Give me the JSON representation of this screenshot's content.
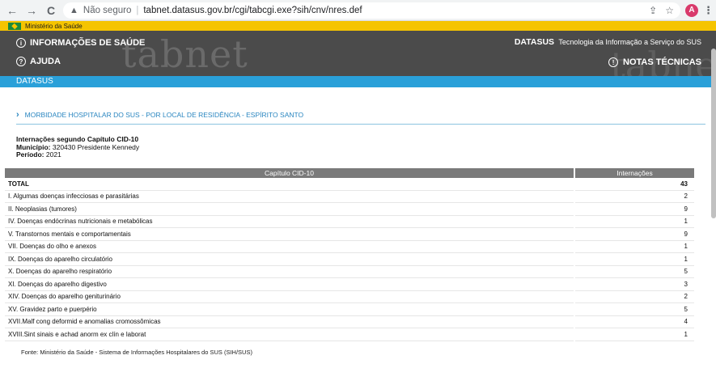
{
  "browser": {
    "back": "←",
    "forward": "→",
    "reload": "C",
    "warning_icon": "▲",
    "security_text": "Não seguro",
    "url": "tabnet.datasus.gov.br/cgi/tabcgi.exe?sih/cnv/nres.def",
    "share_icon": "⇪",
    "star_icon": "☆",
    "avatar_letter": "A",
    "menu_icon": "⋮"
  },
  "gov": {
    "label": "Ministério da Saúde"
  },
  "header": {
    "watermark": "tabnet",
    "info_label": "INFORMAÇÕES DE SAÚDE",
    "help_label": "AJUDA",
    "brand_name": "DATASUS",
    "brand_tagline": "Tecnologia da Informação a Serviço do SUS",
    "notes_label": "NOTAS TÉCNICAS"
  },
  "subbar": {
    "label": "DATASUS"
  },
  "report": {
    "title": "MORBIDADE HOSPITALAR DO SUS - POR LOCAL DE RESIDÊNCIA - ESPÍRITO SANTO",
    "subtitle": "Internações segundo Capítulo CID-10",
    "municipio_label": "Município:",
    "municipio_value": "320430 Presidente Kennedy",
    "periodo_label": "Período:",
    "periodo_value": "2021"
  },
  "table": {
    "headers": [
      "Capítulo CID-10",
      "Internações"
    ],
    "total": {
      "label": "TOTAL",
      "value": "43"
    },
    "rows": [
      {
        "label": "I. Algumas doenças infecciosas e parasitárias",
        "value": "2"
      },
      {
        "label": "II. Neoplasias (tumores)",
        "value": "9"
      },
      {
        "label": "IV. Doenças endócrinas nutricionais e metabólicas",
        "value": "1"
      },
      {
        "label": "V. Transtornos mentais e comportamentais",
        "value": "9"
      },
      {
        "label": "VII. Doenças do olho e anexos",
        "value": "1"
      },
      {
        "label": "IX. Doenças do aparelho circulatório",
        "value": "1"
      },
      {
        "label": "X. Doenças do aparelho respiratório",
        "value": "5"
      },
      {
        "label": "XI. Doenças do aparelho digestivo",
        "value": "3"
      },
      {
        "label": "XIV. Doenças do aparelho geniturinário",
        "value": "2"
      },
      {
        "label": "XV. Gravidez parto e puerpério",
        "value": "5"
      },
      {
        "label": "XVII.Malf cong deformid e anomalias cromossômicas",
        "value": "4"
      },
      {
        "label": "XVIII.Sint sinais e achad anorm ex clín e laborat",
        "value": "1"
      }
    ]
  },
  "footer": {
    "source": "Fonte: Ministério da Saúde - Sistema de Informações Hospitalares do SUS (SIH/SUS)"
  }
}
